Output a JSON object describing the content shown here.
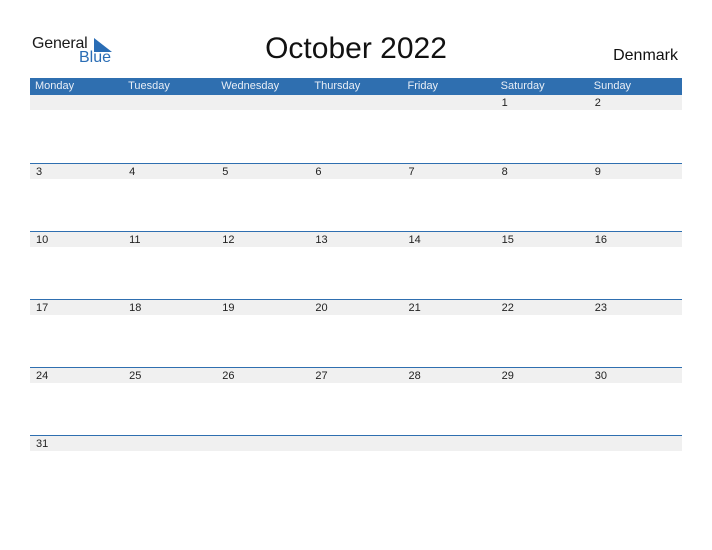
{
  "logo": {
    "text_general": "General",
    "text_blue": "Blue",
    "icon": "triangle-flag-icon"
  },
  "header": {
    "title": "October 2022",
    "country": "Denmark"
  },
  "colors": {
    "accent": "#2f6fb0",
    "band": "#f0f0f0"
  },
  "weekdays": [
    "Monday",
    "Tuesday",
    "Wednesday",
    "Thursday",
    "Friday",
    "Saturday",
    "Sunday"
  ],
  "weeks": [
    [
      "",
      "",
      "",
      "",
      "",
      "1",
      "2"
    ],
    [
      "3",
      "4",
      "5",
      "6",
      "7",
      "8",
      "9"
    ],
    [
      "10",
      "11",
      "12",
      "13",
      "14",
      "15",
      "16"
    ],
    [
      "17",
      "18",
      "19",
      "20",
      "21",
      "22",
      "23"
    ],
    [
      "24",
      "25",
      "26",
      "27",
      "28",
      "29",
      "30"
    ],
    [
      "31",
      "",
      "",
      "",
      "",
      "",
      ""
    ]
  ]
}
